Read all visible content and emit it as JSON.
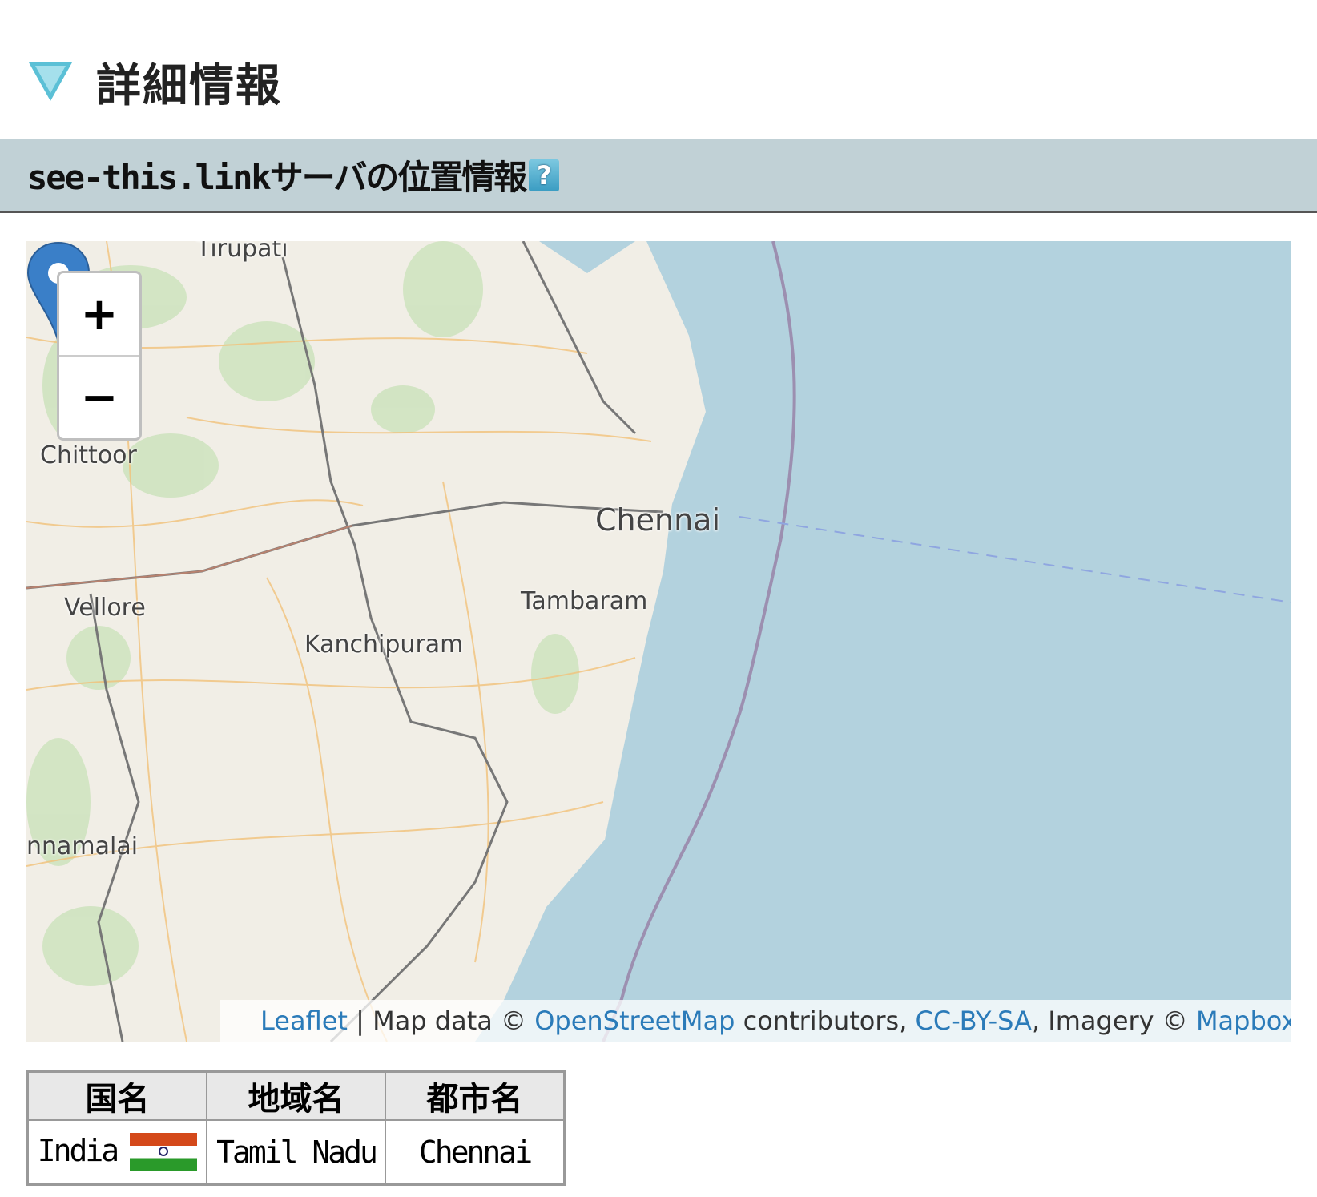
{
  "section_title": "詳細情報",
  "subsection": {
    "title": "see-this.linkサーバの位置情報",
    "help_label": "?"
  },
  "map": {
    "labels": {
      "tirupati": "Tirupati",
      "chittoor": "Chittoor",
      "vellore": "Vellore",
      "kanchipuram": "Kanchipuram",
      "tambaram": "Tambaram",
      "chennai": "Chennai",
      "tiruvannamalai": "nnamalai"
    },
    "zoom_in": "+",
    "zoom_out": "−",
    "attribution": {
      "leaflet": "Leaflet",
      "sep": " | Map data © ",
      "osm": "OpenStreetMap",
      "contrib": " contributors, ",
      "license": "CC-BY-SA",
      "imagery": ", Imagery © ",
      "mapbox": "Mapbox"
    },
    "colors": {
      "land": "#f1eee6",
      "sea": "#b3d2de",
      "marker": "#3a7fc8"
    }
  },
  "location_table": {
    "headers": [
      "国名",
      "地域名",
      "都市名"
    ],
    "row": {
      "country": "India",
      "region": "Tamil Nadu",
      "city": "Chennai"
    }
  }
}
